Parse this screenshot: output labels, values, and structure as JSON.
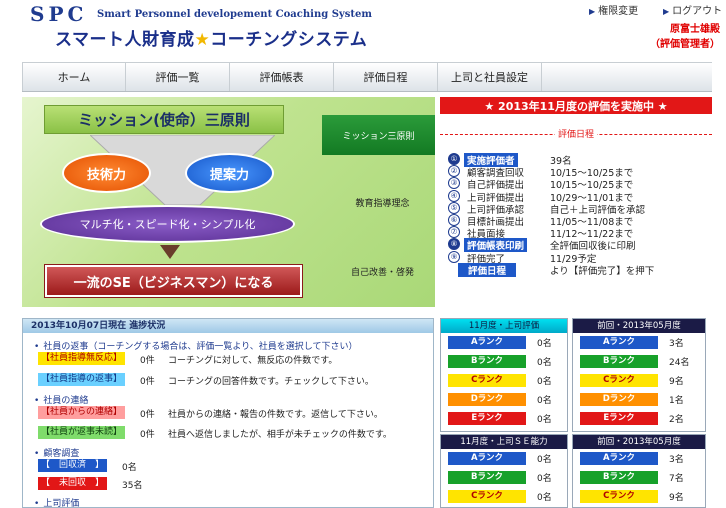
{
  "header": {
    "logo_spc": "SPC",
    "logo_en": "Smart Personnel developement Coaching System",
    "logo_jp_pre": "スマート人財育成",
    "logo_jp_star": "★",
    "logo_jp_post": "コーチングシステム",
    "links": [
      "権限変更",
      "ログアウト"
    ],
    "user_name": "原富士雄殿",
    "user_role": "（評価管理者）"
  },
  "nav": [
    "ホーム",
    "評価一覧",
    "評価帳表",
    "評価日程",
    "上司と社員設定"
  ],
  "hero": {
    "title": "ミッション(使命）三原則",
    "skill": "技術力",
    "proposal": "提案力",
    "multi": "マルチ化・スピード化・シンプル化",
    "goal": "一流のSE（ビジネスマン）になる",
    "side_items": [
      "ミッション三原則",
      "教育指導理念",
      "自己改善・啓発"
    ]
  },
  "evaluation": {
    "banner": "★ 2013年11月度の評価を実施中 ★",
    "subtitle": "評価日程",
    "rows": [
      {
        "num": "①",
        "label": "実施評価者",
        "value": "39名",
        "hl": true
      },
      {
        "num": "②",
        "label": "顧客調査回収",
        "value": "10/15～10/25まで",
        "hl": false
      },
      {
        "num": "③",
        "label": "自己評価提出",
        "value": "10/15～10/25まで",
        "hl": false
      },
      {
        "num": "④",
        "label": "上司評価提出",
        "value": "10/29～11/01まで",
        "hl": false
      },
      {
        "num": "⑤",
        "label": "上司評価承認",
        "value": "自己＋上司評価を承認",
        "hl": false
      },
      {
        "num": "⑥",
        "label": "目標計画提出",
        "value": "11/05～11/08まで",
        "hl": false
      },
      {
        "num": "⑦",
        "label": "社員面接",
        "value": "11/12～11/22まで",
        "hl": false
      },
      {
        "num": "⑧",
        "label": "評価帳表印刷",
        "value": "全評価回収後に印刷",
        "hl": true
      },
      {
        "num": "⑨",
        "label": "評価完了",
        "value": "11/29予定",
        "hl": false
      },
      {
        "num": "",
        "label": "評価日程",
        "value": "より【評価完了】を押下",
        "hl": true
      }
    ]
  },
  "progress": {
    "title": "2013年10月07日現在 進捗状況",
    "sec1": "社員の返事（コーチングする場合は、評価一覧より、社員を選択して下さい）",
    "r1_badge": "【社員指導無反応】",
    "r1_count": "0件",
    "r1_text": "コーチングに対して、無反応の件数です。",
    "r2_badge": "【社員指導の返事】",
    "r2_count": "0件",
    "r2_text": "コーチングの回答件数です。チェックして下さい。",
    "sec2": "社員の連絡",
    "r3_badge": "【社員からの連絡】",
    "r3_count": "0件",
    "r3_text": "社員からの連絡・報告の件数です。返信して下さい。",
    "r4_badge": "【社員が返事未読】",
    "r4_count": "0件",
    "r4_text": "社員へ返信しましたが、相手が未チェックの件数です。",
    "sec3": "顧客調査",
    "r5_badge": "【　回収済　】",
    "r5_count": "0名",
    "r6_badge": "【　未回収　】",
    "r6_count": "35名",
    "sec4": "上司評価"
  },
  "ranks": {
    "t1": {
      "title": "11月度・上司評価",
      "rows": [
        [
          "Aランク",
          "0名"
        ],
        [
          "Bランク",
          "0名"
        ],
        [
          "Cランク",
          "0名"
        ],
        [
          "Dランク",
          "0名"
        ],
        [
          "Eランク",
          "0名"
        ]
      ]
    },
    "t2": {
      "title": "前回・2013年05月度",
      "rows": [
        [
          "Aランク",
          "3名"
        ],
        [
          "Bランク",
          "24名"
        ],
        [
          "Cランク",
          "9名"
        ],
        [
          "Dランク",
          "1名"
        ],
        [
          "Eランク",
          "2名"
        ]
      ]
    },
    "t3": {
      "title": "11月度・上司ＳＥ能力",
      "rows": [
        [
          "Aランク",
          "0名"
        ],
        [
          "Bランク",
          "0名"
        ],
        [
          "Cランク",
          "0名"
        ]
      ]
    },
    "t4": {
      "title": "前回・2013年05月度",
      "rows": [
        [
          "Aランク",
          "3名"
        ],
        [
          "Bランク",
          "7名"
        ],
        [
          "Cランク",
          "9名"
        ]
      ]
    }
  }
}
